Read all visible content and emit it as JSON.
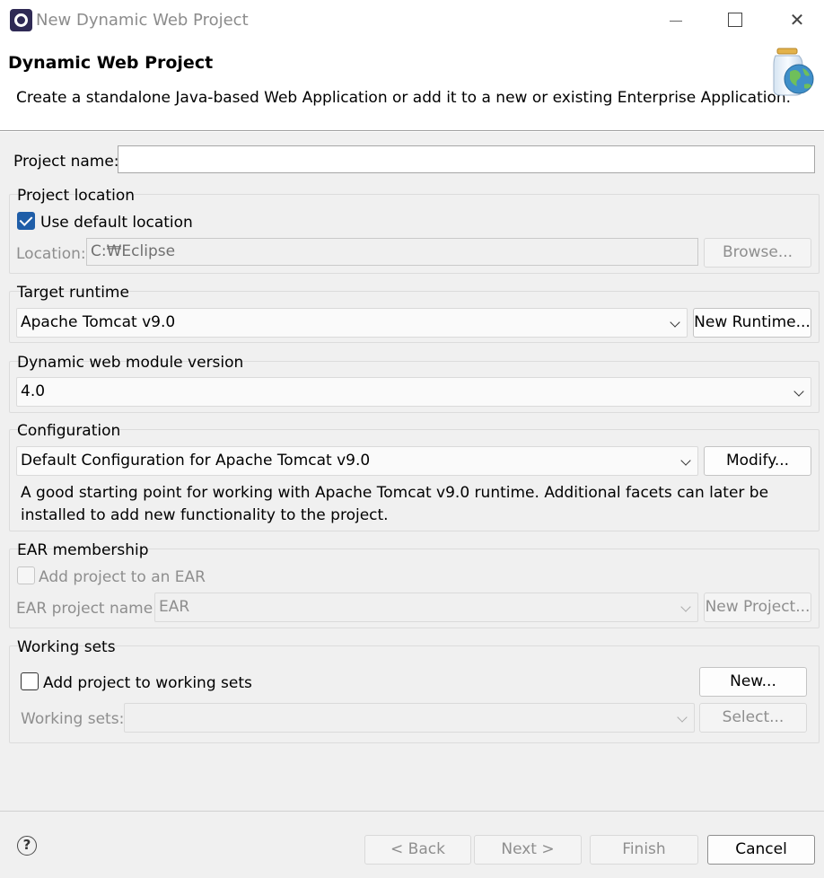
{
  "window": {
    "title": "New Dynamic Web Project",
    "close_glyph": "✕"
  },
  "header": {
    "title": "Dynamic Web Project",
    "description": "Create a standalone Java-based Web Application or add it to a new or existing Enterprise Application."
  },
  "project_name": {
    "label": "Project name:",
    "value": ""
  },
  "project_location": {
    "title": "Project location",
    "use_default_label": "Use default location",
    "use_default_checked": true,
    "location_label": "Location:",
    "location_value": "C:₩Eclipse",
    "browse_label": "Browse..."
  },
  "target_runtime": {
    "title": "Target runtime",
    "selected": "Apache Tomcat v9.0",
    "new_runtime_label": "New Runtime..."
  },
  "web_module": {
    "title": "Dynamic web module version",
    "selected": "4.0"
  },
  "configuration": {
    "title": "Configuration",
    "selected": "Default Configuration for Apache Tomcat v9.0",
    "modify_label": "Modify...",
    "description": "A good starting point for working with Apache Tomcat v9.0 runtime. Additional facets can later be installed to add new functionality to the project."
  },
  "ear_membership": {
    "title": "EAR membership",
    "add_label": "Add project to an EAR",
    "add_checked": false,
    "project_name_label": "EAR project name:",
    "project_name_value": "EAR",
    "new_project_label": "New Project..."
  },
  "working_sets": {
    "title": "Working sets",
    "add_label": "Add project to working sets",
    "add_checked": false,
    "new_label": "New...",
    "sets_label": "Working sets:",
    "sets_value": "",
    "select_label": "Select..."
  },
  "footer": {
    "help_glyph": "?",
    "back_label": "< Back",
    "next_label": "Next >",
    "finish_label": "Finish",
    "cancel_label": "Cancel"
  },
  "icons": {
    "app": "eclipse-icon",
    "header": "jar-globe-icon",
    "help": "help-icon"
  }
}
